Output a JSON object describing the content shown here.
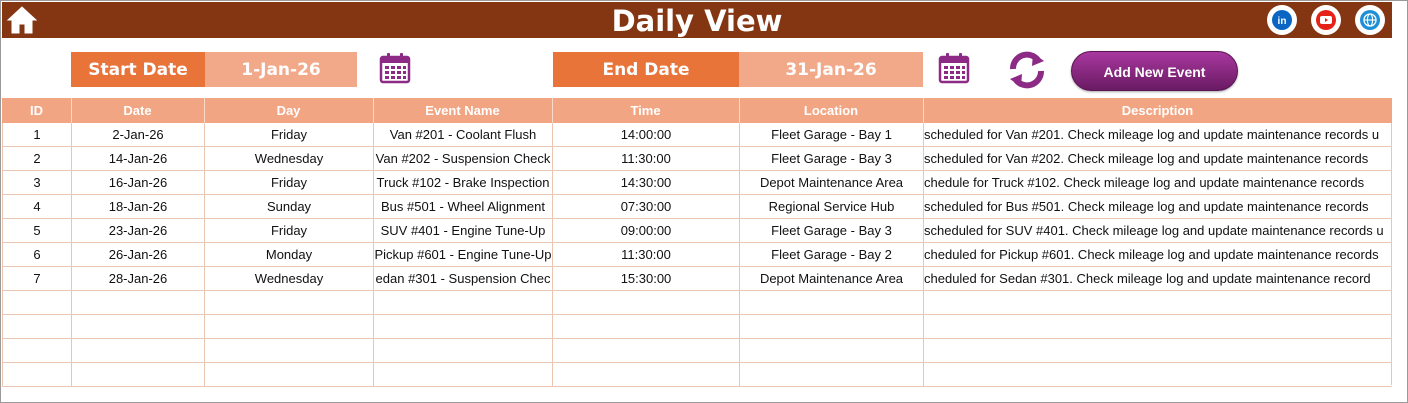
{
  "header": {
    "title": "Daily View",
    "home_icon": "home-icon",
    "social": [
      {
        "name": "linkedin-icon",
        "color": "#0a66c2",
        "glyph": "in"
      },
      {
        "name": "youtube-icon",
        "color": "#e62117",
        "glyph": "▶"
      },
      {
        "name": "globe-icon",
        "color": "#1e8fd6",
        "glyph": "◍"
      }
    ],
    "bg_color": "#843512"
  },
  "toolbar": {
    "start_label": "Start Date",
    "start_value": "1-Jan-26",
    "end_label": "End Date",
    "end_value": "31-Jan-26",
    "add_event_label": "Add New Event",
    "calendar_icon": "calendar-icon",
    "refresh_icon": "refresh-icon",
    "accent_color": "#e8743a",
    "value_color": "#f2a98a",
    "button_color": "#8a2782"
  },
  "table": {
    "columns": [
      "ID",
      "Date",
      "Day",
      "Event Name",
      "Time",
      "Location",
      "Description"
    ],
    "rows": [
      {
        "id": "1",
        "date": "2-Jan-26",
        "day": "Friday",
        "event": "Van #201 - Coolant Flush",
        "time": "14:00:00",
        "location": "Fleet Garage - Bay 1",
        "description": "scheduled for Van #201. Check mileage log and update maintenance records u"
      },
      {
        "id": "2",
        "date": "14-Jan-26",
        "day": "Wednesday",
        "event": "Van #202 - Suspension Check",
        "time": "11:30:00",
        "location": "Fleet Garage - Bay 3",
        "description": "scheduled for Van #202. Check mileage log and update maintenance records"
      },
      {
        "id": "3",
        "date": "16-Jan-26",
        "day": "Friday",
        "event": "Truck #102 - Brake Inspection",
        "time": "14:30:00",
        "location": "Depot Maintenance Area",
        "description": "chedule for Truck #102. Check mileage log and update maintenance records"
      },
      {
        "id": "4",
        "date": "18-Jan-26",
        "day": "Sunday",
        "event": "Bus #501 - Wheel Alignment",
        "time": "07:30:00",
        "location": "Regional Service Hub",
        "description": "scheduled for Bus #501. Check mileage log and update maintenance records"
      },
      {
        "id": "5",
        "date": "23-Jan-26",
        "day": "Friday",
        "event": "SUV #401 - Engine Tune-Up",
        "time": "09:00:00",
        "location": "Fleet Garage - Bay 3",
        "description": "scheduled for SUV #401. Check mileage log and update maintenance records u"
      },
      {
        "id": "6",
        "date": "26-Jan-26",
        "day": "Monday",
        "event": "Pickup #601 - Engine Tune-Up",
        "time": "11:30:00",
        "location": "Fleet Garage - Bay 2",
        "description": "cheduled for Pickup #601. Check mileage log and update maintenance records"
      },
      {
        "id": "7",
        "date": "28-Jan-26",
        "day": "Wednesday",
        "event": "edan #301 - Suspension Chec",
        "time": "15:30:00",
        "location": "Depot Maintenance Area",
        "description": "cheduled for Sedan #301. Check mileage log and update maintenance record"
      },
      {
        "id": "",
        "date": "",
        "day": "",
        "event": "",
        "time": "",
        "location": "",
        "description": ""
      },
      {
        "id": "",
        "date": "",
        "day": "",
        "event": "",
        "time": "",
        "location": "",
        "description": ""
      },
      {
        "id": "",
        "date": "",
        "day": "",
        "event": "",
        "time": "",
        "location": "",
        "description": ""
      },
      {
        "id": "",
        "date": "",
        "day": "",
        "event": "",
        "time": "",
        "location": "",
        "description": ""
      }
    ],
    "header_color": "#f2a583",
    "grid_color": "#e8c6b1"
  }
}
